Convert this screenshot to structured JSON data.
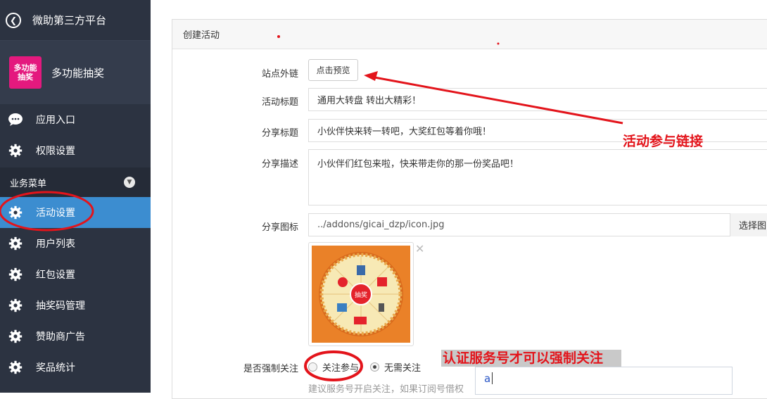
{
  "app": {
    "title": "微助第三方平台"
  },
  "module": {
    "logo_line1": "多功能",
    "logo_line2": "抽奖",
    "name": "多功能抽奖"
  },
  "nav": {
    "top_items": [
      {
        "label": "应用入口",
        "icon": "chat-bubble-icon"
      },
      {
        "label": "权限设置",
        "icon": "gear-icon"
      }
    ],
    "section": "业务菜单",
    "items": [
      {
        "label": "活动设置",
        "icon": "gear-icon",
        "active": true
      },
      {
        "label": "用户列表",
        "icon": "gear-icon"
      },
      {
        "label": "红包设置",
        "icon": "gear-icon"
      },
      {
        "label": "抽奖码管理",
        "icon": "gear-icon"
      },
      {
        "label": "赞助商广告",
        "icon": "gear-icon"
      },
      {
        "label": "奖品统计",
        "icon": "gear-icon"
      }
    ]
  },
  "panel": {
    "title": "创建活动"
  },
  "form": {
    "site_link_label": "站点外链",
    "site_link_button": "点击预览",
    "activity_title_label": "活动标题",
    "activity_title_value": "通用大转盘 转出大精彩！",
    "share_title_label": "分享标题",
    "share_title_value": "小伙伴快来转一转吧，大奖红包等着你哦！",
    "share_desc_label": "分享描述",
    "share_desc_value": "小伙伴们红包来啦，快来带走你的那一份奖品吧！",
    "share_icon_label": "分享图标",
    "share_icon_value": "../addons/gicai_dzp/icon.jpg",
    "choose_button": "选择图",
    "wheel_center": "抽奖",
    "follow_label": "是否强制关注",
    "follow_opt1": "关注参与",
    "follow_opt2": "无需关注",
    "hint": "建议服务号开启关注，如果订阅号借权"
  },
  "annotations": {
    "link_note": "活动参与链接",
    "follow_note": "认证服务号才可以强制关注",
    "ime_text": "a"
  },
  "colors": {
    "sidebar": "#2c3341",
    "active": "#3c8dd0",
    "annotation": "#e3141b"
  }
}
